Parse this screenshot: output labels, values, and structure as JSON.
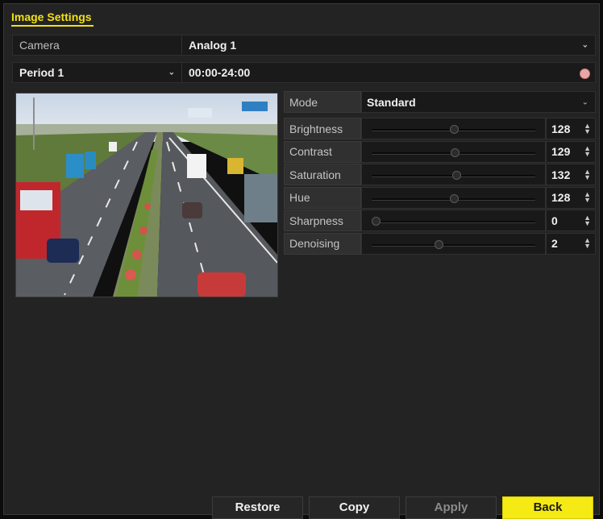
{
  "title": "Image Settings",
  "camera": {
    "label": "Camera",
    "value": "Analog 1"
  },
  "period": {
    "label": "Period 1",
    "value": "00:00-24:00"
  },
  "mode": {
    "label": "Mode",
    "value": "Standard"
  },
  "sliders": [
    {
      "label": "Brightness",
      "value": "128",
      "level": 0.5
    },
    {
      "label": "Contrast",
      "value": "129",
      "level": 0.506
    },
    {
      "label": "Saturation",
      "value": "132",
      "level": 0.518
    },
    {
      "label": "Hue",
      "value": "128",
      "level": 0.5
    },
    {
      "label": "Sharpness",
      "value": "0",
      "level": 0.0
    },
    {
      "label": "Denoising",
      "value": "2",
      "level": 0.4
    }
  ],
  "buttons": {
    "restore": "Restore",
    "copy": "Copy",
    "apply": "Apply",
    "back": "Back"
  },
  "colors": {
    "accent": "#f2e016",
    "primary_button": "#f6ea14"
  },
  "icons": {
    "period_clock": "clock-icon",
    "dropdown": "chevron-down-icon",
    "spinner": "spinner-arrows-icon"
  }
}
